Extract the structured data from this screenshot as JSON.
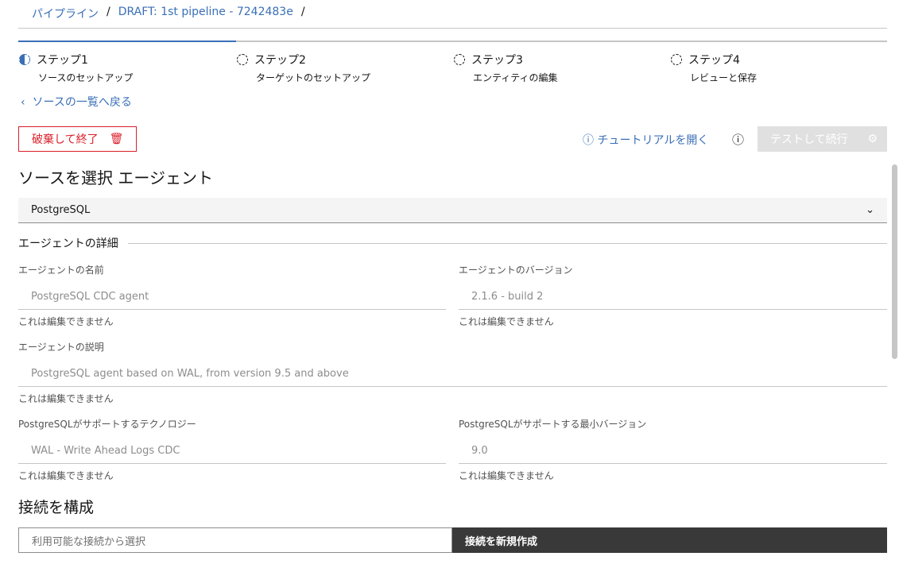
{
  "breadcrumb": [
    "パイプライン",
    "DRAFT: 1st pipeline - 7242483e"
  ],
  "steps": [
    {
      "title": "ステップ1",
      "sub": "ソースのセットアップ"
    },
    {
      "title": "ステップ2",
      "sub": "ターゲットのセットアップ"
    },
    {
      "title": "ステップ3",
      "sub": "エンティティの編集"
    },
    {
      "title": "ステップ4",
      "sub": "レビューと保存"
    }
  ],
  "back": "ソースの一覧へ戻る",
  "discard": "破棄して終了",
  "tutorial": "チュートリアルを開く",
  "test_continue": "テストして続行",
  "source_title": "ソースを選択 エージェント",
  "agent_select": "PostgreSQL",
  "details_title": "エージェントの詳細",
  "fields": [
    {
      "label": "エージェントの名前",
      "value": "PostgreSQL CDC agent",
      "help": "これは編集できません"
    },
    {
      "label": "エージェントのバージョン",
      "value": "2.1.6 - build 2",
      "help": "これは編集できません"
    },
    {
      "label": "エージェントの説明",
      "value": "PostgreSQL agent based on WAL, from version 9.5 and above",
      "help": "これは編集できません"
    },
    {
      "label": "PostgreSQLがサポートするテクノロジー",
      "value": "WAL - Write Ahead Logs CDC",
      "help": "これは編集できません"
    },
    {
      "label": "PostgreSQLがサポートする最小バージョン",
      "value": "9.0",
      "help": "これは編集できません"
    }
  ],
  "connect_title": "接続を構成",
  "connection_placeholder": "利用可能な接続から選択",
  "new_connection": "接続を新規作成"
}
